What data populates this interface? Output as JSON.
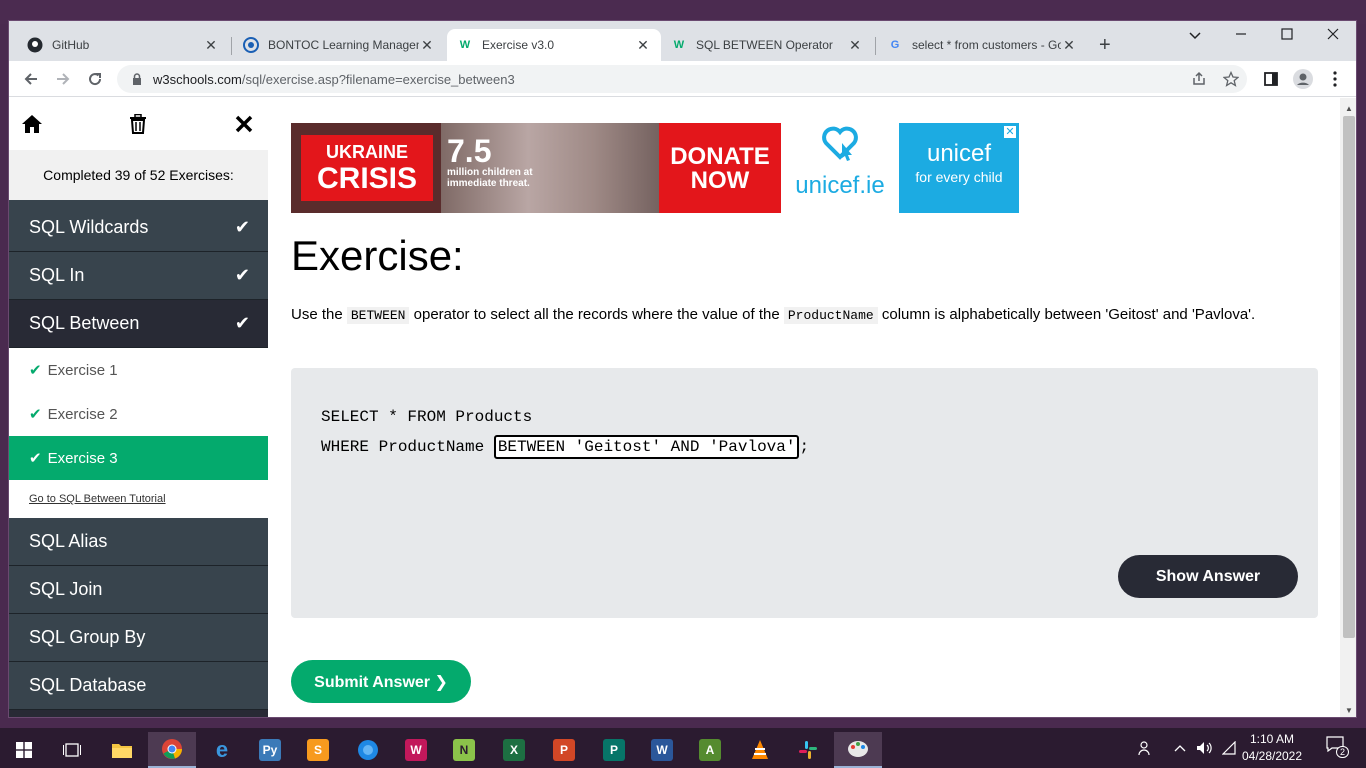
{
  "browser": {
    "tabs": [
      {
        "title": "GitHub",
        "icon": "github-icon"
      },
      {
        "title": "BONTOC Learning Managem",
        "icon": "moodle-icon"
      },
      {
        "title": "Exercise v3.0",
        "icon": "w3schools-icon",
        "active": true
      },
      {
        "title": "SQL BETWEEN Operator",
        "icon": "w3schools-icon"
      },
      {
        "title": "select * from customers - Go",
        "icon": "google-icon"
      }
    ],
    "close_glyph": "✕",
    "new_tab_glyph": "+",
    "url_host": "w3schools.com",
    "url_path": "/sql/exercise.asp?filename=exercise_between3"
  },
  "sidebar": {
    "progress": "Completed 39 of 52 Exercises:",
    "topics_before": [
      {
        "label": "SQL Wildcards",
        "done": true
      },
      {
        "label": "SQL In",
        "done": true
      },
      {
        "label": "SQL Between",
        "done": true
      }
    ],
    "exercises": [
      {
        "label": "Exercise 1"
      },
      {
        "label": "Exercise 2"
      },
      {
        "label": "Exercise 3",
        "active": true
      }
    ],
    "tutorial_link": "Go to SQL Between Tutorial",
    "topics_after": [
      {
        "label": "SQL Alias"
      },
      {
        "label": "SQL Join"
      },
      {
        "label": "SQL Group By"
      },
      {
        "label": "SQL Database"
      }
    ]
  },
  "ad": {
    "badge_line1": "UKRAINE",
    "badge_line2": "CRISIS",
    "number": "7.5",
    "small": "million children at immediate threat.",
    "donate_line1": "DONATE",
    "donate_line2": "NOW",
    "site": "unicef.ie",
    "brand": "unicef",
    "tagline": "for every child",
    "close": "✕"
  },
  "exercise": {
    "title": "Exercise:",
    "desc_1": "Use the",
    "code_1": "BETWEEN",
    "desc_2": "operator to select all the records where the value of the",
    "code_2": "ProductName",
    "desc_3": "column is alphabetically between 'Geitost' and 'Pavlova'.",
    "code_line1": "SELECT * FROM Products",
    "code_line2_prefix": "WHERE ProductName ",
    "answer_input": "BETWEEN 'Geitost' AND 'Pavlova'",
    "code_line2_suffix": ";",
    "show_answer": "Show Answer",
    "submit": "Submit Answer ❯"
  },
  "taskbar": {
    "time": "1:10 AM",
    "date": "04/28/2022",
    "notifications": "2"
  },
  "colors": {
    "w3_green": "#04aa6d",
    "sidebar_dark": "#38444d",
    "button_dark": "#282a35",
    "unicef_blue": "#1cabe2"
  }
}
